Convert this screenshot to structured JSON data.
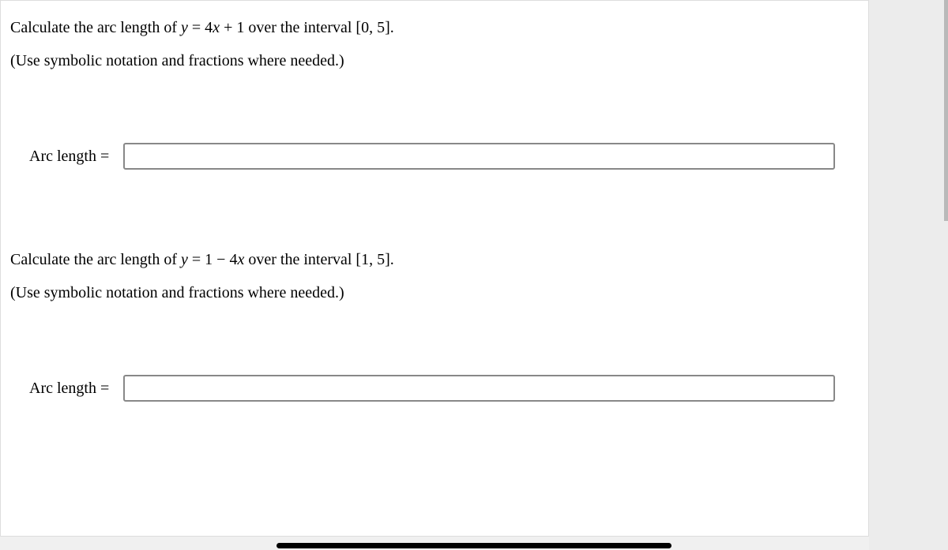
{
  "question1": {
    "prompt_pre": "Calculate the arc length of ",
    "equation_y": "y",
    "equation_eq": " = 4",
    "equation_x": "x",
    "equation_post": " + 1 over the interval [0, 5].",
    "hint": "(Use symbolic notation and fractions where needed.)",
    "answer_label": "Arc length =",
    "answer_value": ""
  },
  "question2": {
    "prompt_pre": "Calculate the arc length of ",
    "equation_y": "y",
    "equation_eq": " = 1 − 4",
    "equation_x": "x",
    "equation_post": " over the interval [1, 5].",
    "hint": "(Use symbolic notation and fractions where needed.)",
    "answer_label": "Arc length =",
    "answer_value": ""
  }
}
